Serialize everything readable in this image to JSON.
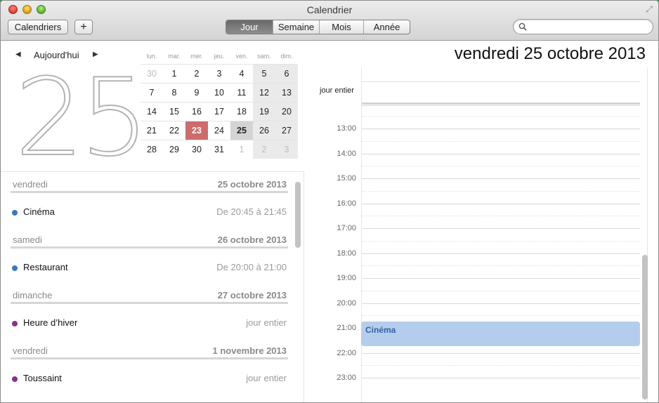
{
  "window": {
    "title": "Calendrier"
  },
  "toolbar": {
    "calendars_label": "Calendriers",
    "add_label": "+",
    "views": [
      {
        "label": "Jour",
        "active": true
      },
      {
        "label": "Semaine",
        "active": false
      },
      {
        "label": "Mois",
        "active": false
      },
      {
        "label": "Année",
        "active": false
      }
    ],
    "search_placeholder": ""
  },
  "nav": {
    "today_label": "Aujourd'hui"
  },
  "big_day": "25",
  "mini_calendar": {
    "weekdays": [
      "lun.",
      "mar.",
      "mer.",
      "jeu.",
      "ven.",
      "sam.",
      "dim."
    ],
    "weeks": [
      [
        {
          "d": "30",
          "s": "other"
        },
        {
          "d": "1"
        },
        {
          "d": "2"
        },
        {
          "d": "3"
        },
        {
          "d": "4"
        },
        {
          "d": "5",
          "s": "weekend"
        },
        {
          "d": "6",
          "s": "weekend"
        }
      ],
      [
        {
          "d": "7"
        },
        {
          "d": "8"
        },
        {
          "d": "9"
        },
        {
          "d": "10"
        },
        {
          "d": "11"
        },
        {
          "d": "12",
          "s": "weekend"
        },
        {
          "d": "13",
          "s": "weekend"
        }
      ],
      [
        {
          "d": "14"
        },
        {
          "d": "15"
        },
        {
          "d": "16"
        },
        {
          "d": "17"
        },
        {
          "d": "18"
        },
        {
          "d": "19",
          "s": "weekend"
        },
        {
          "d": "20",
          "s": "weekend"
        }
      ],
      [
        {
          "d": "21"
        },
        {
          "d": "22"
        },
        {
          "d": "23",
          "s": "today"
        },
        {
          "d": "24"
        },
        {
          "d": "25",
          "s": "sel"
        },
        {
          "d": "26",
          "s": "weekend"
        },
        {
          "d": "27",
          "s": "weekend"
        }
      ],
      [
        {
          "d": "28"
        },
        {
          "d": "29"
        },
        {
          "d": "30"
        },
        {
          "d": "31"
        },
        {
          "d": "1",
          "s": "other"
        },
        {
          "d": "2",
          "s": "other weekend"
        },
        {
          "d": "3",
          "s": "other weekend"
        }
      ]
    ]
  },
  "agenda": [
    {
      "day": "vendredi",
      "date": "25 octobre 2013",
      "event": "Cinéma",
      "time": "De 20:45 à 21:45",
      "color": "#3a78c0"
    },
    {
      "day": "samedi",
      "date": "26 octobre 2013",
      "event": "Restaurant",
      "time": "De 20:00 à 21:00",
      "color": "#3a78c0"
    },
    {
      "day": "dimanche",
      "date": "27 octobre 2013",
      "event": "Heure d’hiver",
      "time": "jour entier",
      "color": "#8a2f8f"
    },
    {
      "day": "vendredi",
      "date": "1 novembre 2013",
      "event": "Toussaint",
      "time": "jour entier",
      "color": "#8a2f8f"
    }
  ],
  "day_view": {
    "title": "vendredi 25 octobre 2013",
    "allday_label": "jour entier",
    "hours": [
      "13:00",
      "14:00",
      "15:00",
      "16:00",
      "17:00",
      "18:00",
      "19:00",
      "20:00",
      "21:00",
      "22:00",
      "23:00"
    ],
    "event": {
      "title": "Cinéma"
    }
  }
}
